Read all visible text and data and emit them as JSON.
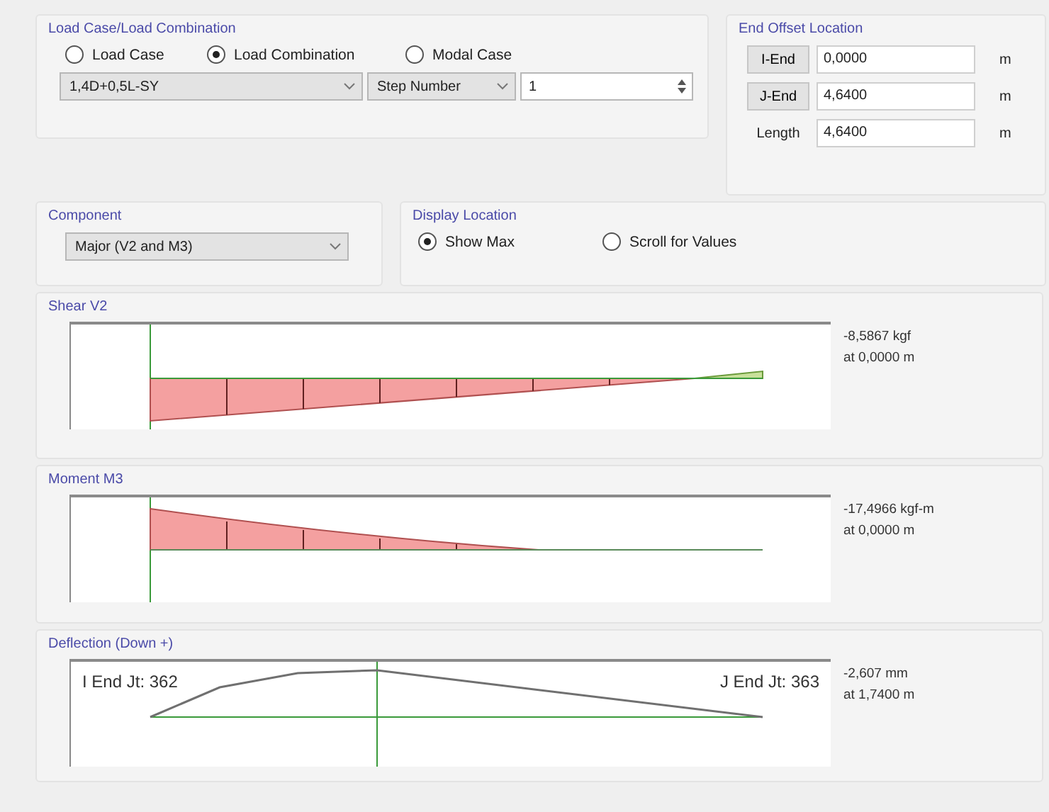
{
  "load_case_group": {
    "title": "Load Case/Load Combination",
    "options": [
      {
        "label": "Load Case",
        "selected": false
      },
      {
        "label": "Load Combination",
        "selected": true
      },
      {
        "label": "Modal Case",
        "selected": false
      }
    ],
    "combo": {
      "value": "1,4D+0,5L-SY"
    },
    "step_type": {
      "value": "Step Number"
    },
    "step": {
      "value": "1"
    }
  },
  "end_offset": {
    "title": "End Offset Location",
    "rows": [
      {
        "kind": "button",
        "label": "I-End",
        "value": "0,0000",
        "unit": "m"
      },
      {
        "kind": "button",
        "label": "J-End",
        "value": "4,6400",
        "unit": "m"
      },
      {
        "kind": "label",
        "label": "Length",
        "value": "4,6400",
        "unit": "m"
      }
    ]
  },
  "component": {
    "title": "Component",
    "value": "Major (V2 and M3)"
  },
  "display_location": {
    "title": "Display Location",
    "options": [
      {
        "label": "Show Max",
        "selected": true
      },
      {
        "label": "Scroll for Values",
        "selected": false
      }
    ]
  },
  "diagrams": [
    {
      "kind": "shear",
      "title": "Shear V2",
      "max": "-8,5867 kgf",
      "at": "at 0,0000 m"
    },
    {
      "kind": "moment",
      "title": "Moment M3",
      "max": "-17,4966 kgf-m",
      "at": "at 0,0000 m"
    },
    {
      "kind": "deflection",
      "title": "Deflection (Down +)",
      "i_end": "I End Jt: 362",
      "j_end": "J End Jt: 363",
      "max": "-2,607 mm",
      "at": "at 1,7400 m"
    }
  ]
}
